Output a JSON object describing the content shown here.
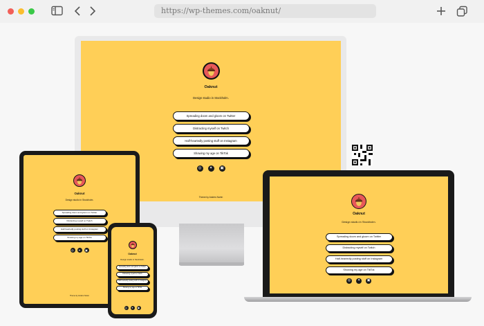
{
  "browser": {
    "url": "https://wp-themes.com/oaknut/",
    "controls": [
      "close",
      "minimize",
      "maximize"
    ],
    "colors": {
      "close": "#f25f58",
      "minimize": "#fbbe2e",
      "maximize": "#3ac948"
    }
  },
  "site": {
    "name": "Oaknut",
    "tagline": "Design studio in Stockholm.",
    "links": [
      "Spreading doom and gloom on Twitter",
      "Distracting myself on Twitch",
      "Half-heartedly posting stuff on Instagram",
      "Showing my age on TikTok"
    ],
    "social_icons": [
      "instagram-icon",
      "twitter-icon",
      "linkedin-icon"
    ],
    "footer": "Theme by Anders Norén",
    "colors": {
      "background": "#ffcf57",
      "logo": "#e85858",
      "text": "#111111"
    }
  },
  "devices": [
    "desktop-monitor",
    "tablet",
    "phone",
    "laptop"
  ]
}
